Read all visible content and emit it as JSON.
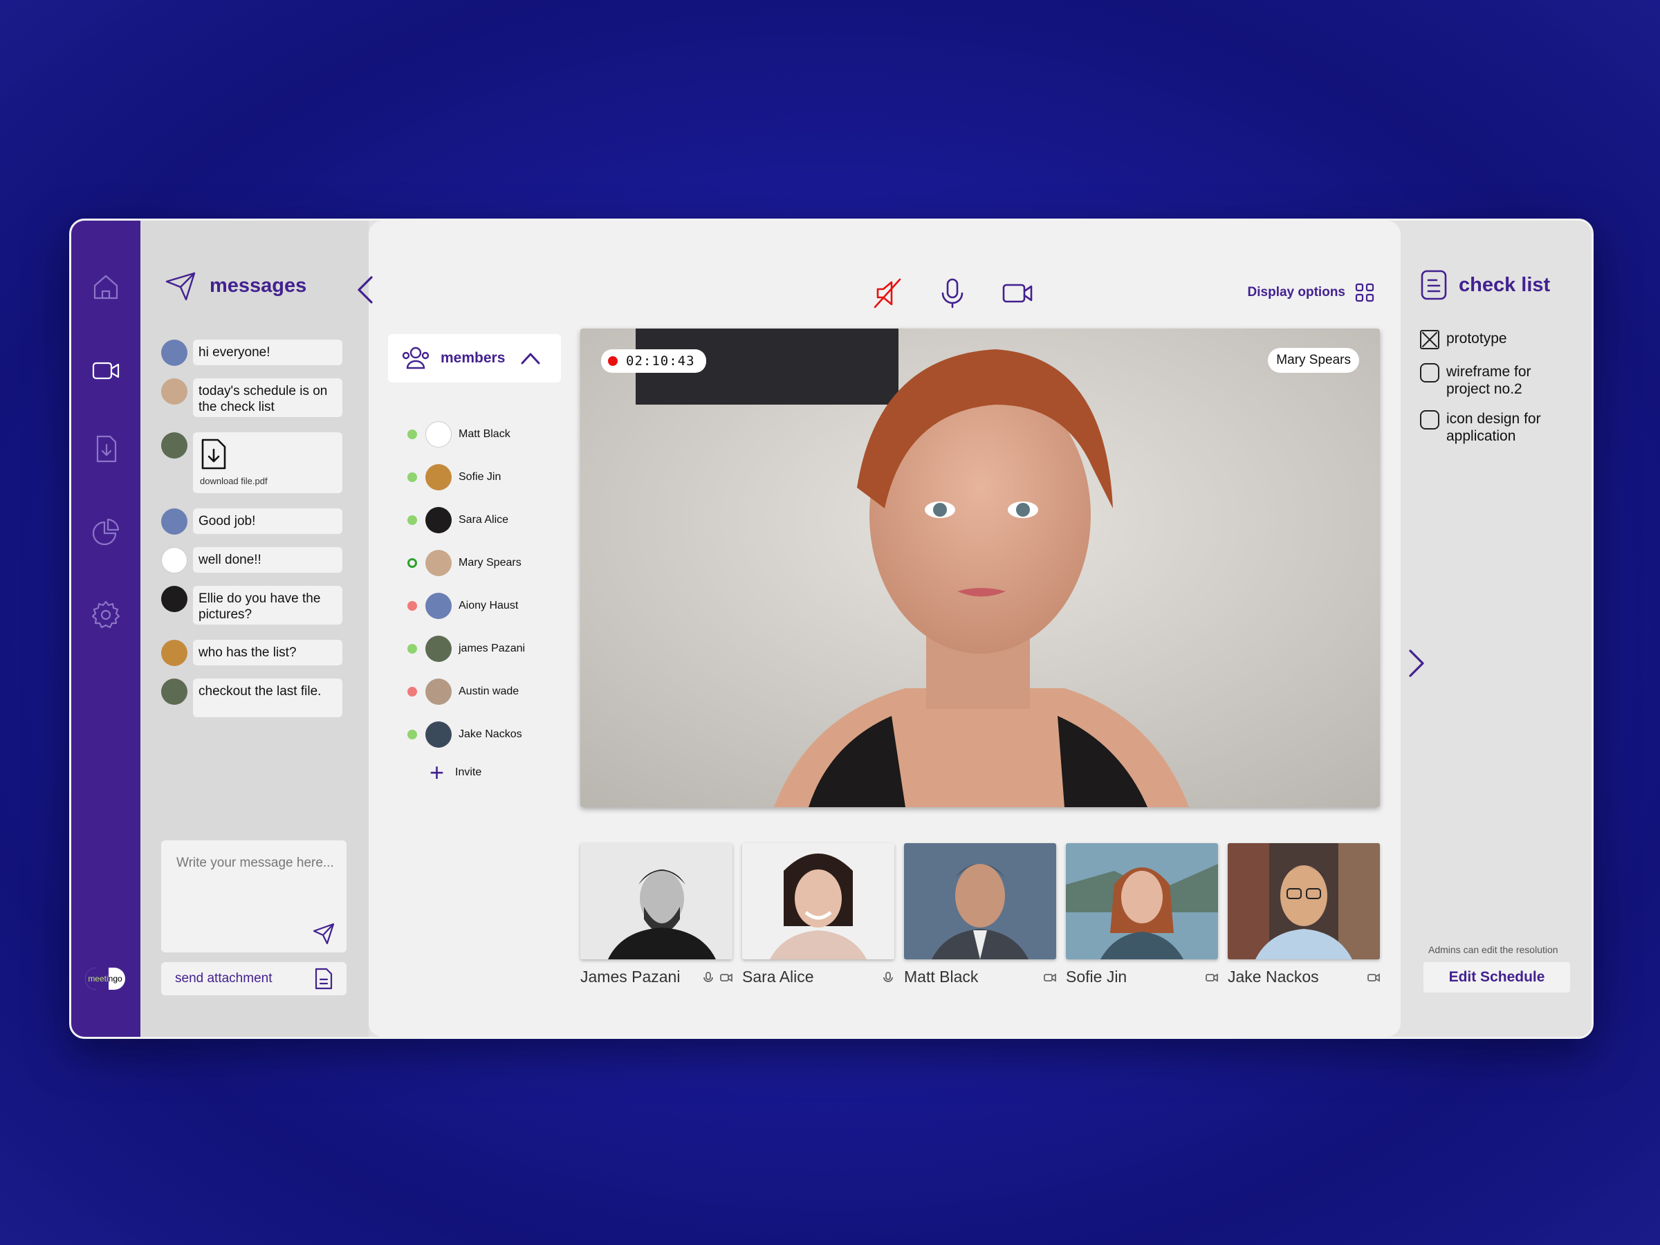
{
  "app": {
    "brand": "meetingo"
  },
  "nav": [
    "home-icon",
    "video-icon",
    "download-icon",
    "pie-chart-icon",
    "settings-icon"
  ],
  "messages": {
    "title": "messages",
    "items": [
      {
        "text": "hi everyone!",
        "avatar": "#6a7fb4"
      },
      {
        "text": "today's schedule is on the check list",
        "avatar": "#c9a88c"
      },
      {
        "file": "download file.pdf",
        "avatar": "#5d6b52"
      },
      {
        "text": "Good job!",
        "avatar": "#6a7fb4"
      },
      {
        "text": "well done!!",
        "avatar": "#ffffff"
      },
      {
        "text": "Ellie do you have the pictures?",
        "avatar": "#1d1b1b"
      },
      {
        "text": "who has the list?",
        "avatar": "#c48a3c"
      },
      {
        "text": "checkout the last file.",
        "avatar": "#5d6b52"
      }
    ],
    "composer_placeholder": "Write your message here...",
    "attachment_label": "send attachment"
  },
  "call": {
    "display_options": "Display options",
    "timer": "02:10:43",
    "speaker": "Mary Spears",
    "controls": [
      "speaker-muted-icon",
      "microphone-icon",
      "camera-icon"
    ]
  },
  "members": {
    "title": "members",
    "list": [
      {
        "name": "Matt Black",
        "status": "online",
        "color": "#8fd46f"
      },
      {
        "name": "Sofie Jin",
        "status": "online",
        "color": "#8fd46f"
      },
      {
        "name": "Sara Alice",
        "status": "online",
        "color": "#8fd46f"
      },
      {
        "name": "Mary Spears",
        "status": "speaking",
        "color": "#2ea12e"
      },
      {
        "name": "Aiony Haust",
        "status": "offline",
        "color": "#f07a7a"
      },
      {
        "name": "james Pazani",
        "status": "online",
        "color": "#8fd46f"
      },
      {
        "name": "Austin wade",
        "status": "offline",
        "color": "#f07a7a"
      },
      {
        "name": "Jake Nackos",
        "status": "online",
        "color": "#8fd46f"
      }
    ],
    "invite": "Invite"
  },
  "participants": [
    {
      "name": "James Pazani",
      "icons": [
        "mic",
        "cam"
      ]
    },
    {
      "name": "Sara Alice",
      "icons": [
        "mic"
      ]
    },
    {
      "name": "Matt Black",
      "icons": [
        "cam"
      ]
    },
    {
      "name": "Sofie Jin",
      "icons": [
        "cam"
      ]
    },
    {
      "name": "Jake Nackos",
      "icons": [
        "cam"
      ]
    }
  ],
  "checklist": {
    "title": "check list",
    "items": [
      {
        "text": "prototype",
        "checked": true
      },
      {
        "text": "wireframe for project no.2",
        "checked": false
      },
      {
        "text": "icon design for application",
        "checked": false
      }
    ],
    "admin_note": "Admins can edit the resolution",
    "edit_button": "Edit Schedule"
  },
  "colors": {
    "accent": "#42218f",
    "background": "#1a1a95",
    "record": "#e81010"
  }
}
